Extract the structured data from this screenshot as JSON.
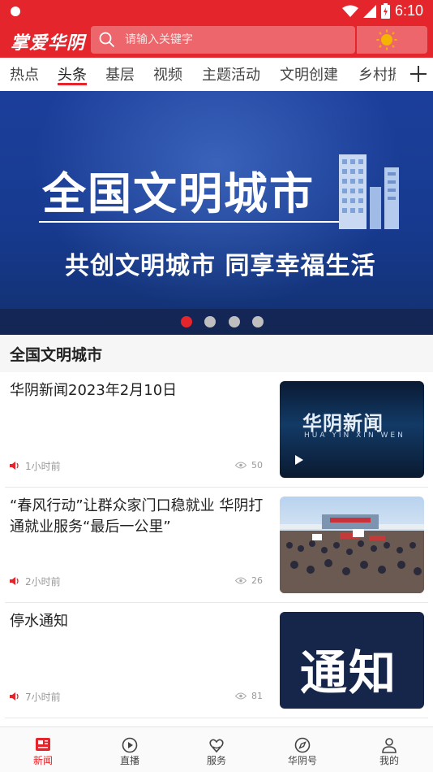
{
  "status_bar": {
    "time": "6:10"
  },
  "header": {
    "logo": "掌爱华阴",
    "search_placeholder": "请输入关键字"
  },
  "tabs": [
    {
      "label": "热点"
    },
    {
      "label": "头条"
    },
    {
      "label": "基层"
    },
    {
      "label": "视频"
    },
    {
      "label": "主题活动"
    },
    {
      "label": "文明创建"
    },
    {
      "label": "乡村振兴"
    }
  ],
  "active_tab": "头条",
  "banner": {
    "title": "全国文明城市",
    "subtitle": "共创文明城市 同享幸福生活",
    "slide_count": 4,
    "active_slide": 1
  },
  "section": {
    "title": "全国文明城市"
  },
  "news": [
    {
      "title": "华阴新闻2023年2月10日",
      "time": "1小时前",
      "views": "50",
      "thumb_title": "华阴新闻",
      "thumb_subtitle": "HUA YIN XIN WEN"
    },
    {
      "title": "“春风行动”让群众家门口稳就业 华阴打通就业服务“最后一公里”",
      "time": "2小时前",
      "views": "26"
    },
    {
      "title": "停水通知",
      "time": "7小时前",
      "views": "81",
      "thumb_title": "通知"
    }
  ],
  "bottom_nav": [
    {
      "label": "新闻",
      "icon": "news-icon"
    },
    {
      "label": "直播",
      "icon": "play-circle-icon"
    },
    {
      "label": "服务",
      "icon": "service-heart-icon"
    },
    {
      "label": "华阴号",
      "icon": "compass-icon"
    },
    {
      "label": "我的",
      "icon": "user-icon"
    }
  ],
  "colors": {
    "brand": "#e5252c",
    "banner_blue": "#1c3f9c"
  }
}
